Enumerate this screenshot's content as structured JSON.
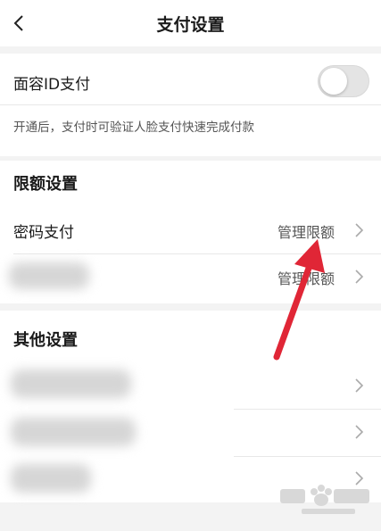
{
  "header": {
    "title": "支付设置",
    "back_icon": "chevron-left-icon"
  },
  "face_id": {
    "label": "面容ID支付",
    "enabled": false,
    "hint": "开通后，支付时可验证人脸支付快速完成付款"
  },
  "limits": {
    "section_title": "限额设置",
    "rows": [
      {
        "label": "密码支付",
        "action": "管理限额"
      },
      {
        "action": "管理限额"
      }
    ]
  },
  "other": {
    "section_title": "其他设置"
  },
  "colors": {
    "arrow": "#e02636",
    "toggle_off": "#e4e4e4"
  }
}
